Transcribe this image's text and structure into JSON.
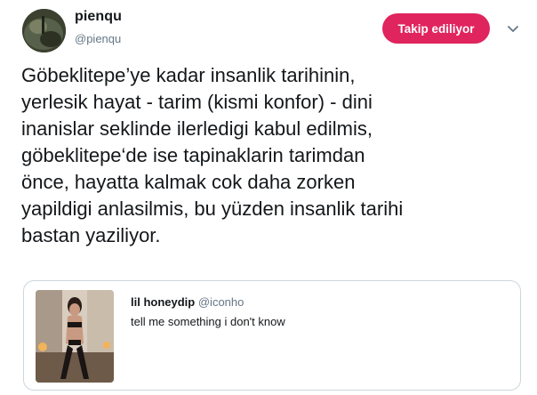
{
  "tweet": {
    "author": {
      "name": "pienqu",
      "handle": "@pienqu"
    },
    "follow_label": "Takip ediliyor",
    "text_lines": [
      "Göbeklitepe’ye kadar insanlik tarihinin,",
      "yerlesik hayat - tarim (kismi konfor) - dini",
      "inanislar seklinde ilerledigi kabul edilmis,",
      "göbeklitepe‘de ise tapinaklarin tarimdan",
      "önce, hayatta kalmak cok daha zorken",
      "yapildigi anlasilmis, bu yüzden insanlik tarihi",
      "bastan yaziliyor."
    ]
  },
  "quoted_tweet": {
    "name": "lil honeydip",
    "handle": "@iconho",
    "text": "tell me something i don't know"
  },
  "colors": {
    "follow_button_bg": "#e0245e",
    "text_primary": "#14171a",
    "text_secondary": "#657786",
    "card_border": "#ccd6dd"
  },
  "icons": {
    "more_menu": "chevron-down-icon"
  }
}
